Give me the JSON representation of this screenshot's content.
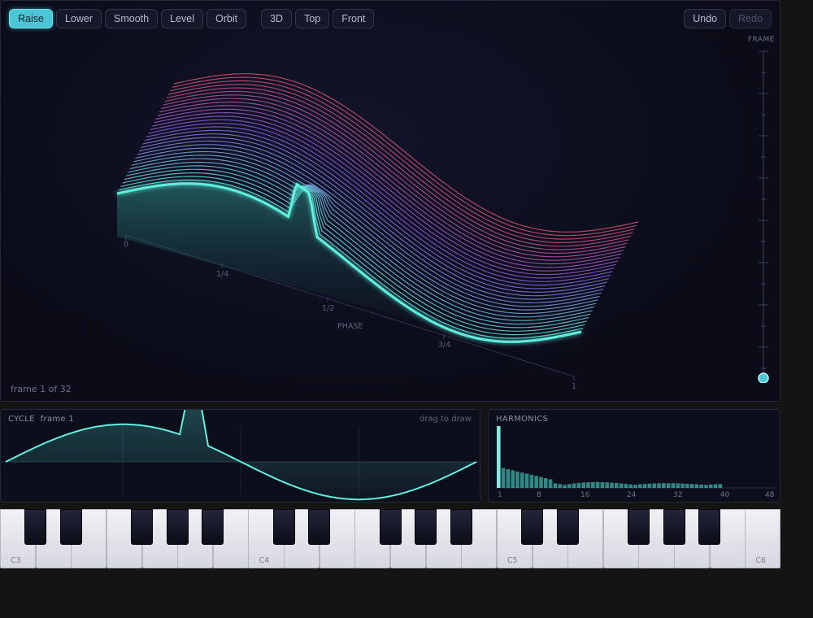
{
  "toolbar": {
    "edit_buttons": [
      "Raise",
      "Lower",
      "Smooth",
      "Level",
      "Orbit"
    ],
    "active_edit": "Raise",
    "view_buttons": [
      "3D",
      "Top",
      "Front"
    ],
    "undo_label": "Undo",
    "redo_label": "Redo"
  },
  "view3d": {
    "phase_ticks": [
      "0",
      "1/4",
      "1/2",
      "3/4",
      "1"
    ],
    "phase_axis_label": "PHASE",
    "frame_status": "frame 1 of 32",
    "frame_count": 32,
    "current_frame": 1,
    "frame_slider_label": "FRAME"
  },
  "cycle": {
    "title": "CYCLE",
    "frame_label": "frame 1",
    "hint": "drag to draw"
  },
  "harmonics": {
    "title": "HARMONICS",
    "tick_labels": [
      "1",
      "8",
      "16",
      "24",
      "32",
      "40",
      "48"
    ],
    "bin_count": 48
  },
  "keyboard": {
    "octave_labels": [
      "C3",
      "C4",
      "C5",
      "C6"
    ],
    "white_key_count": 22
  },
  "colors": {
    "accent": "#4cc6d6",
    "wave_cyan": "#5ff0df",
    "wave_magenta": "#d2506e",
    "wave_violet": "#8a5ad8",
    "panel_bg": "#0d0e1c"
  }
}
